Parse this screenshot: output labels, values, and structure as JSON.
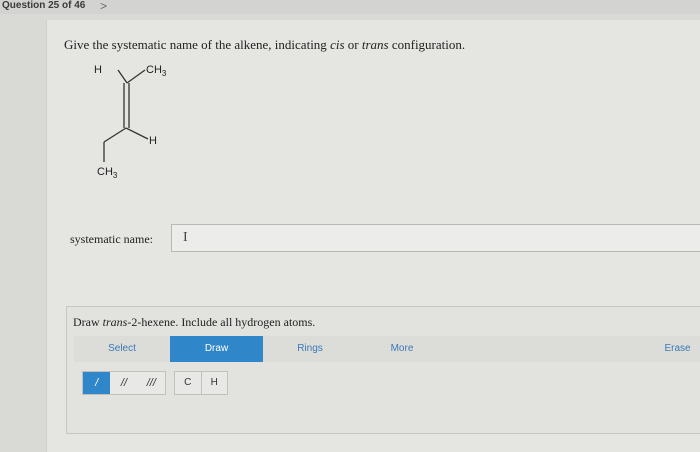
{
  "header": {
    "question_counter": "Question 25 of 46",
    "next_icon": ">"
  },
  "question": {
    "prompt_start": "Give the systematic name of the alkene, indicating ",
    "cis": "cis",
    "prompt_mid": " or ",
    "trans": "trans",
    "prompt_end": " configuration."
  },
  "molecule": {
    "top_left": "H",
    "top_right": "CH",
    "top_right_sub": "3",
    "right_h": "H",
    "bottom_left": "CH",
    "bottom_left_sub": "3"
  },
  "answer": {
    "label": "systematic name:",
    "value": "",
    "cursor_glyph": "I"
  },
  "draw": {
    "instruction_start": "Draw ",
    "instruction_italic": "trans",
    "instruction_end": "-2-hexene. Include all hydrogen atoms.",
    "tabs": [
      "Select",
      "Draw",
      "Rings",
      "More",
      "Erase"
    ],
    "active_tab": "Draw",
    "bonds": [
      "/",
      "//",
      "///"
    ],
    "atoms": [
      "C",
      "H"
    ]
  },
  "colors": {
    "accent": "#2f86c8",
    "link": "#3c79b8"
  }
}
